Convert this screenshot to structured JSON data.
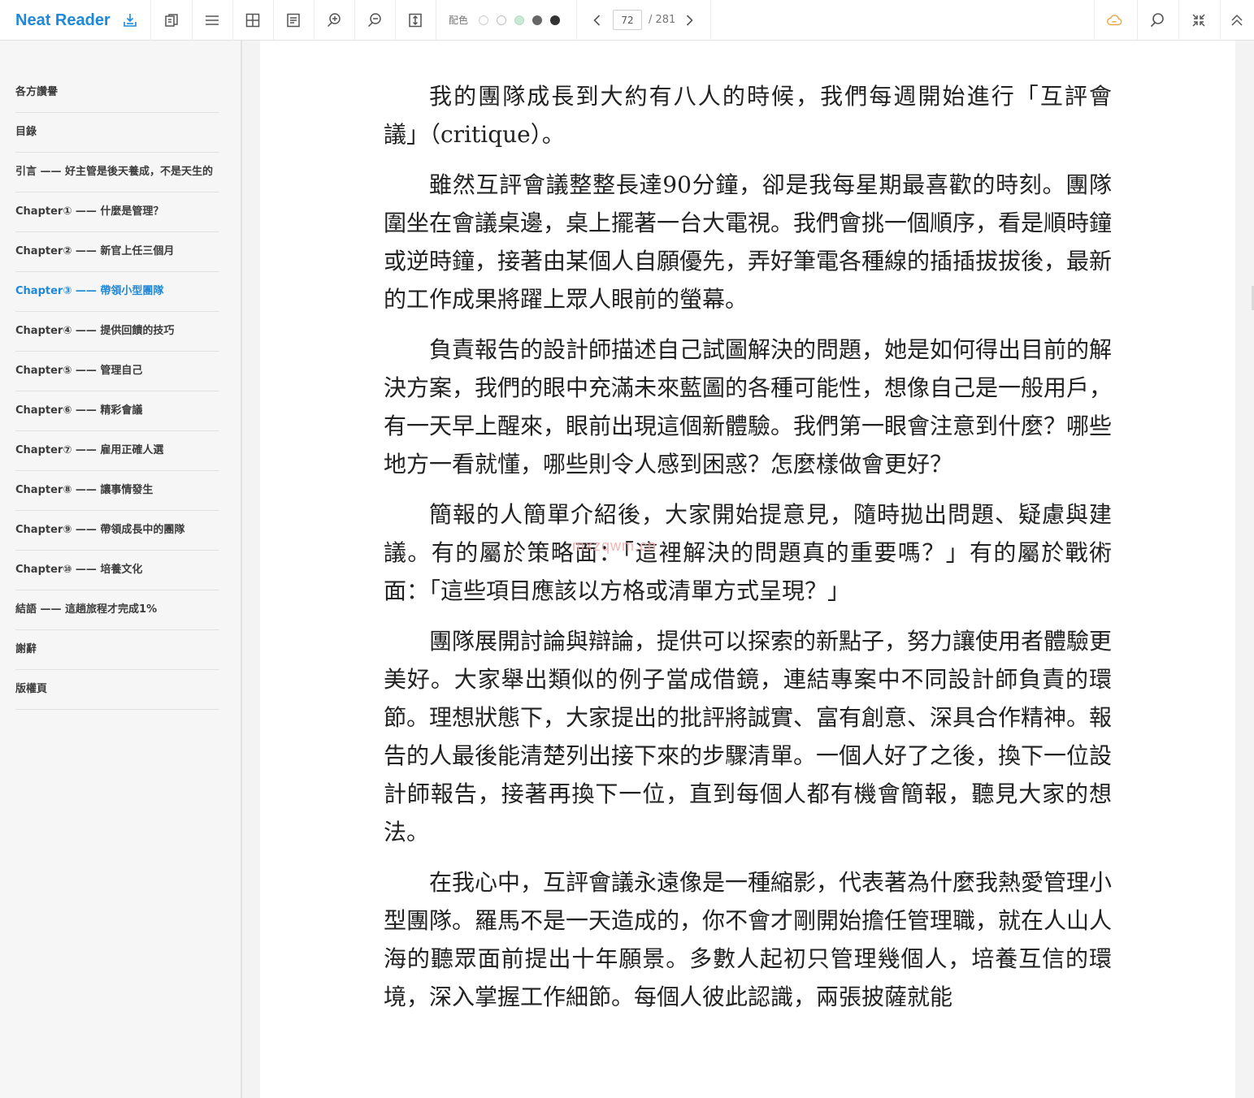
{
  "app": {
    "name": "Neat Reader"
  },
  "toolbar": {
    "color_label": "配色",
    "swatches": [
      "#ffffff",
      "#ffffff",
      "#c9ead6",
      "#666666",
      "#333333"
    ],
    "current_page": "72",
    "total_pages": "/ 281",
    "accent_color": "#1e88d9"
  },
  "sidebar": {
    "items": [
      {
        "label": "各方讚譽"
      },
      {
        "label": "目錄"
      },
      {
        "label": "引言 —— 好主管是後天養成，不是天生的"
      },
      {
        "label": "Chapter① —— 什麼是管理？"
      },
      {
        "label": "Chapter② —— 新官上任三個月"
      },
      {
        "label": "Chapter③ —— 帶領小型團隊"
      },
      {
        "label": "Chapter④ —— 提供回饋的技巧"
      },
      {
        "label": "Chapter⑤ —— 管理自己"
      },
      {
        "label": "Chapter⑥ —— 精彩會議"
      },
      {
        "label": "Chapter⑦ —— 雇用正確人選"
      },
      {
        "label": "Chapter⑧ —— 讓事情發生"
      },
      {
        "label": "Chapter⑨ —— 帶領成長中的團隊"
      },
      {
        "label": "Chapter⑩ —— 培養文化"
      },
      {
        "label": "結語 —— 這趟旅程才完成1%"
      },
      {
        "label": "謝辭"
      },
      {
        "label": "版權頁"
      }
    ],
    "active_index": 5
  },
  "content": {
    "paragraphs": [
      "我的團隊成長到大約有八人的時候，我們每週開始進行「互評會議」（critique）。",
      "雖然互評會議整整長達90分鐘，卻是我每星期最喜歡的時刻。團隊圍坐在會議桌邊，桌上擺著一台大電視。我們會挑一個順序，看是順時鐘或逆時鐘，接著由某個人自願優先，弄好筆電各種線的插插拔拔後，最新的工作成果將躍上眾人眼前的螢幕。",
      "負責報告的設計師描述自己試圖解決的問題，她是如何得出目前的解決方案，我們的眼中充滿未來藍圖的各種可能性，想像自己是一般用戶，有一天早上醒來，眼前出現這個新體驗。我們第一眼會注意到什麼？哪些地方一看就懂，哪些則令人感到困惑？怎麼樣做會更好？",
      "簡報的人簡單介紹後，大家開始提意見，隨時拋出問題、疑慮與建議。有的屬於策略面：「這裡解決的問題真的重要嗎？」有的屬於戰術面：「這些項目應該以方格或清單方式呈現？」",
      "團隊展開討論與辯論，提供可以探索的新點子，努力讓使用者體驗更美好。大家舉出類似的例子當成借鏡，連結專案中不同設計師負責的環節。理想狀態下，大家提出的批評將誠實、富有創意、深具合作精神。報告的人最後能清楚列出接下來的步驟清單。一個人好了之後，換下一位設計師報告，接著再換下一位，直到每個人都有機會簡報，聽見大家的想法。",
      "在我心中，互評會議永遠像是一種縮影，代表著為什麼我熱愛管理小型團隊。羅馬不是一天造成的，你不會才剛開始擔任管理職，就在人山人海的聽眾面前提出十年願景。多數人起初只管理幾個人，培養互信的環境，深入掌握工作細節。每個人彼此認識，兩張披薩就能"
    ],
    "watermark": "mxzqwm.cn"
  }
}
